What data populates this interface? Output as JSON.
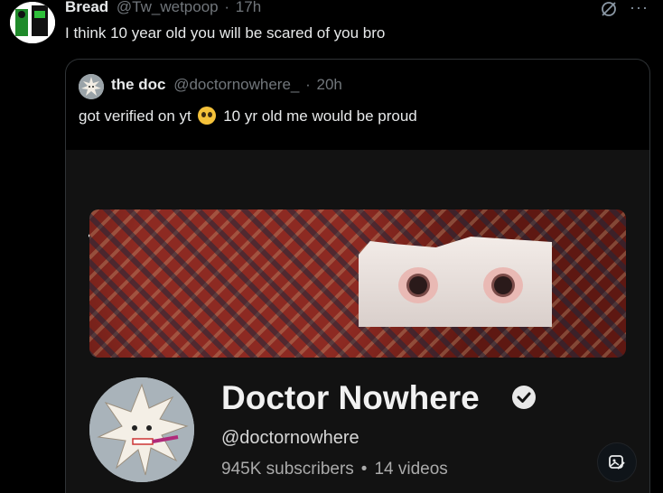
{
  "tweet": {
    "author_name": "Bread",
    "handle": "@Tw_wetpoop",
    "separator": "·",
    "time": "17h",
    "text": "I think 10 year old you will be scared of you bro",
    "more_label": "···"
  },
  "quote": {
    "author_name": "the doc",
    "handle": "@doctornowhere_",
    "separator": "·",
    "time": "20h",
    "text_before": "got verified on yt",
    "text_after": "10 yr old me would be proud"
  },
  "screenshot": {
    "channel_name": "Doctor Nowhere",
    "channel_handle": "@doctornowhere",
    "subscribers": "945K subscribers",
    "stat_separator": "•",
    "videos": "14 videos"
  },
  "colors": {
    "background": "#000000",
    "text_primary": "#e7e9ea",
    "text_secondary": "#71767b",
    "border": "#2f3336"
  }
}
